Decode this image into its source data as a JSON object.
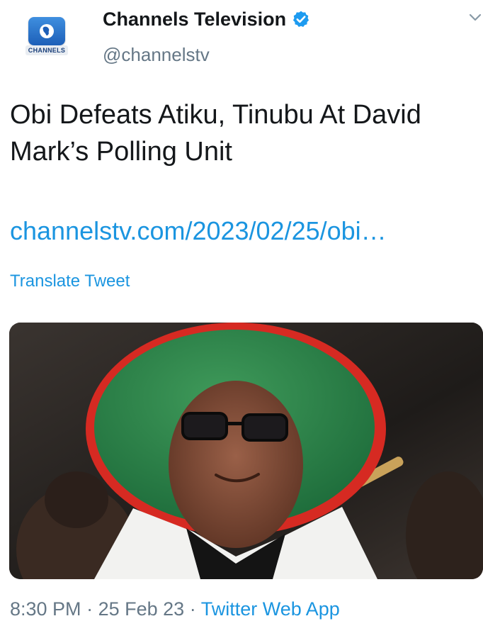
{
  "header": {
    "display_name": "Channels Television",
    "handle": "@channelstv",
    "avatar_brand": "CHANNELS",
    "verified_icon": "verified-badge-icon",
    "caret_icon": "chevron-down-icon"
  },
  "tweet": {
    "text": "Obi Defeats Atiku, Tinubu At David Mark’s Polling Unit",
    "link": "channelstv.com/2023/02/25/obi…",
    "translate_label": "Translate Tweet"
  },
  "media": {
    "alt": "photo"
  },
  "footer": {
    "time": "8:30 PM",
    "separator": "·",
    "date": "25 Feb 23",
    "source": "Twitter Web App"
  },
  "colors": {
    "link": "#1b95e0",
    "secondary_text": "#657786",
    "primary_text": "#14171a",
    "verified": "#1d9bf0"
  }
}
